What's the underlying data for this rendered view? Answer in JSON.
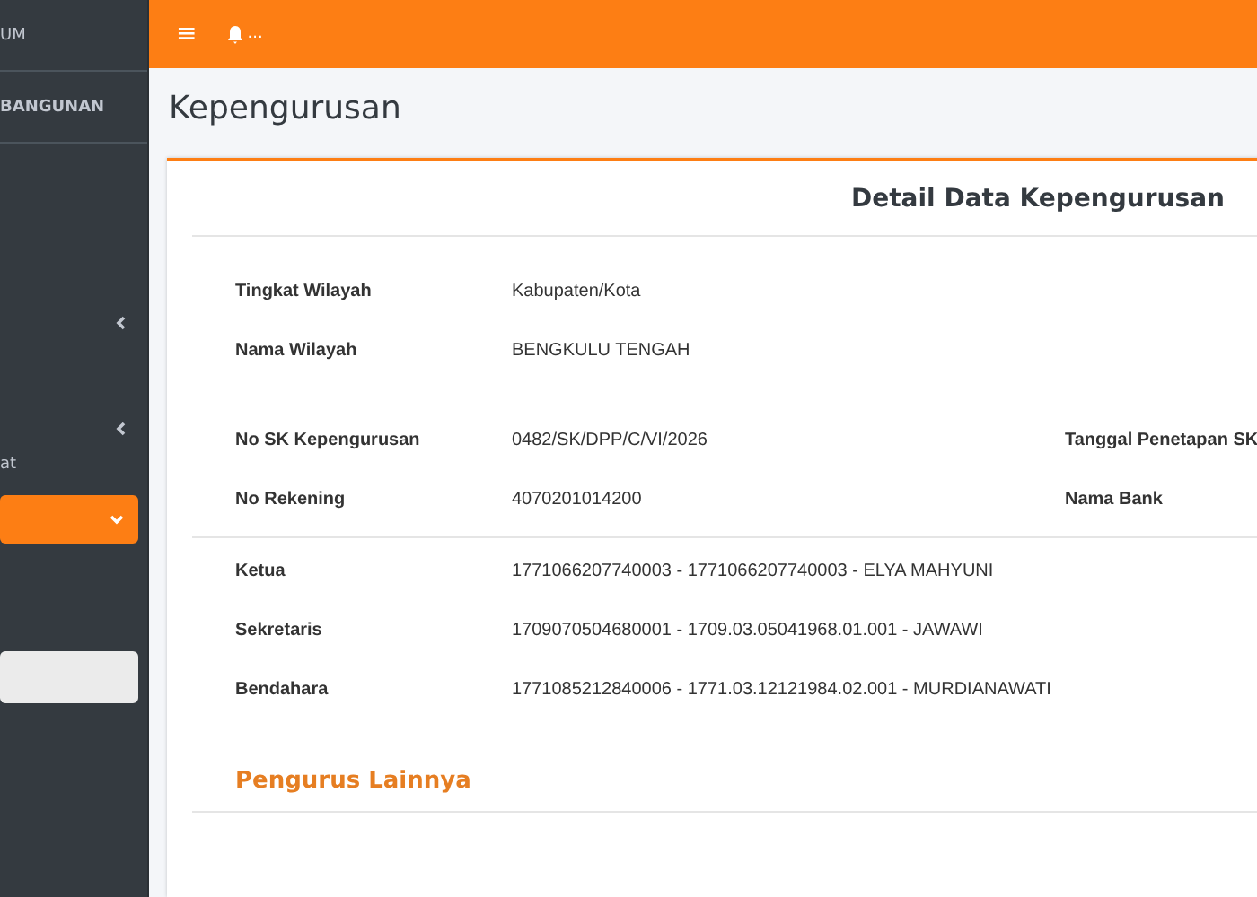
{
  "sidebar": {
    "items": [
      {
        "label": "UM",
        "kind": "text",
        "selected": false
      },
      {
        "label": "BANGUNAN",
        "kind": "text",
        "selected": false
      },
      {
        "kind": "collapsible"
      },
      {
        "kind": "collapsible"
      },
      {
        "label": "at",
        "kind": "text",
        "selected": false
      },
      {
        "kind": "dropdown",
        "selected": true
      },
      {
        "kind": "field"
      }
    ]
  },
  "topbar": {
    "menu_icon": "≡",
    "notification_text": "..."
  },
  "page_title": "Kepengurusan",
  "card": {
    "title": "Detail Data Kepengurusan",
    "groups": [
      {
        "rows": [
          {
            "label": "Tingkat Wilayah",
            "value": "Kabupaten/Kota"
          },
          {
            "label": "Nama Wilayah",
            "value": "BENGKULU TENGAH"
          }
        ]
      },
      {
        "rows": [
          {
            "label": "No SK Kepengurusan",
            "value": "0482/SK/DPP/C/VI/2026",
            "label_2": "Tanggal Penetapan SK"
          },
          {
            "label": "No Rekening",
            "value": "4070201014200",
            "label_2": "Nama Bank"
          }
        ]
      },
      {
        "rows": [
          {
            "label": "Ketua",
            "value": "1771066207740003 - 1771066207740003 - ELYA MAHYUNI"
          },
          {
            "label": "Sekretaris",
            "value": "1709070504680001 - 1709.03.05041968.01.001 - JAWAWI"
          },
          {
            "label": "Bendahara",
            "value": "1771085212840006 - 1771.03.12121984.02.001 - MURDIANAWATI"
          }
        ]
      }
    ],
    "section_title": "Pengurus Lainnya"
  }
}
